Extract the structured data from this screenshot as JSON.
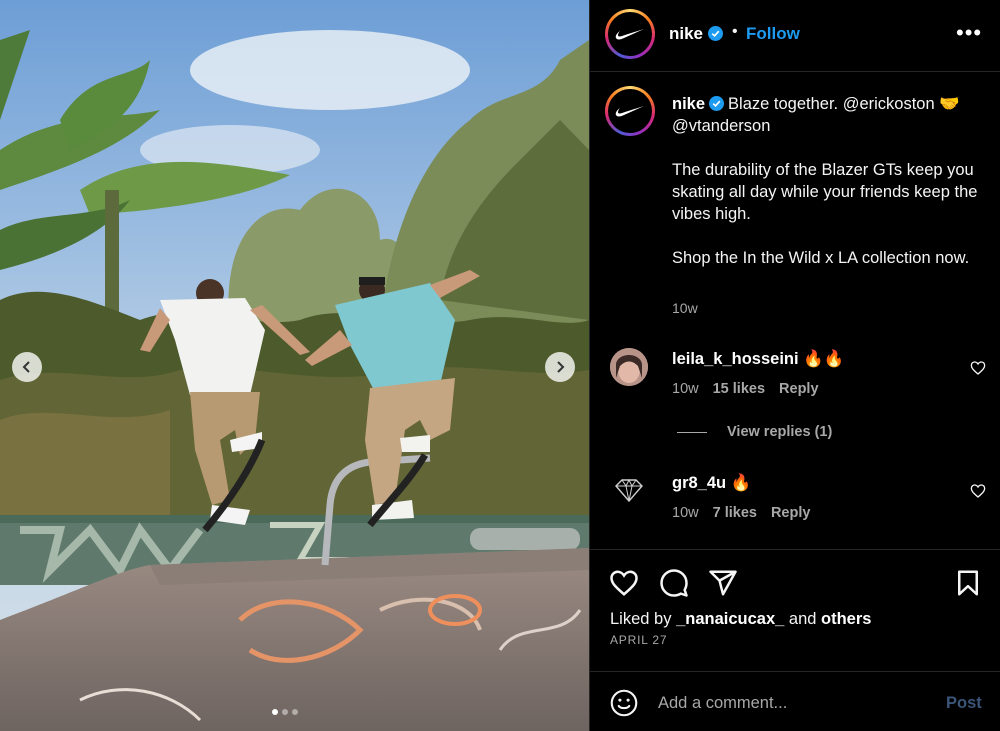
{
  "post": {
    "author": "nike",
    "follow_label": "Follow",
    "bullet": "•",
    "more_label": "•••"
  },
  "caption": {
    "author": "nike",
    "line1": "Blaze together. @erickoston 🤝 @vtanderson",
    "line2": "The durability of the Blazer GTs keep you skating all day while your friends keep the vibes high.",
    "line3": "Shop the In the Wild x LA collection now.",
    "time": "10w"
  },
  "comments": [
    {
      "user": "leila_k_hosseini",
      "text": "🔥🔥",
      "time": "10w",
      "likes": "15 likes",
      "reply": "Reply"
    },
    {
      "user": "gr8_4u",
      "text": "🔥",
      "time": "10w",
      "likes": "7 likes",
      "reply": "Reply"
    }
  ],
  "view_replies": "View replies (1)",
  "likes": {
    "prefix": "Liked by",
    "user": "_nanaicucax_",
    "mid": "and",
    "others": "others"
  },
  "date": "APRIL 27",
  "add_comment": {
    "placeholder": "Add a comment...",
    "post_label": "Post"
  },
  "carousel": {
    "slide_count": 3,
    "active_index": 0
  },
  "colors": {
    "verified": "#1d9bf0",
    "follow": "#1d9bf0",
    "post_disabled": "#3b5578",
    "background": "#000000"
  },
  "icons": [
    "nike-swoosh-icon",
    "verified-icon",
    "more-icon",
    "heart-icon",
    "comment-icon",
    "share-icon",
    "bookmark-icon",
    "emoji-icon",
    "chevron-left-icon",
    "chevron-right-icon"
  ]
}
